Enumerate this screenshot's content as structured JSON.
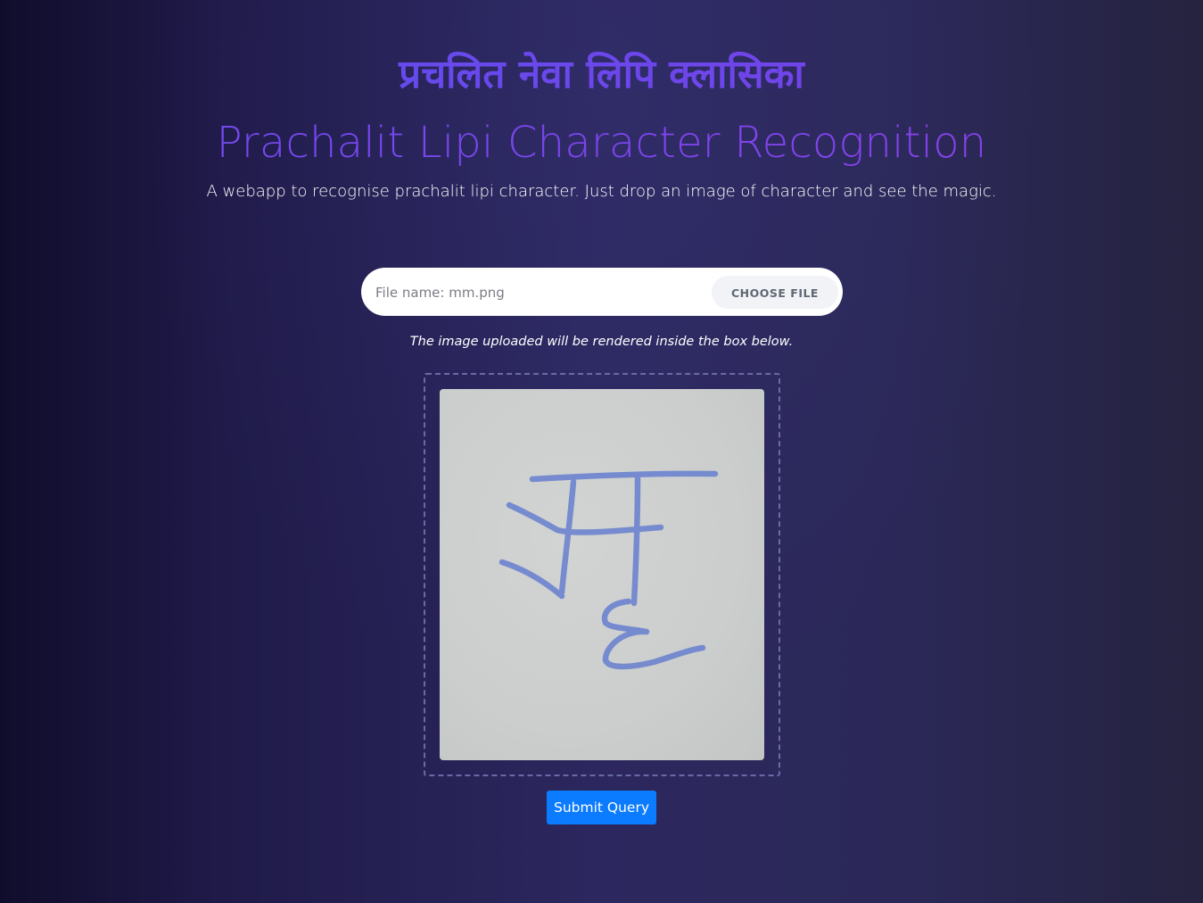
{
  "header": {
    "script_title": "प्रचलित नेवा लिपि क्लासिका",
    "title": "Prachalit Lipi Character Recognition",
    "subtitle": "A webapp to recognise prachalit lipi character. Just drop an image of character and see the magic."
  },
  "upload": {
    "file_name_text": "File name: mm.png",
    "choose_label": "CHOOSE FILE",
    "hint": "The image uploaded will be rendered inside the box below."
  },
  "preview": {
    "icon": "uploaded-character-image"
  },
  "actions": {
    "submit_label": "Submit Query"
  },
  "colors": {
    "accent_primary": "#7a4ff0",
    "submit": "#0b7bff",
    "background_dark": "#1f1a48"
  }
}
